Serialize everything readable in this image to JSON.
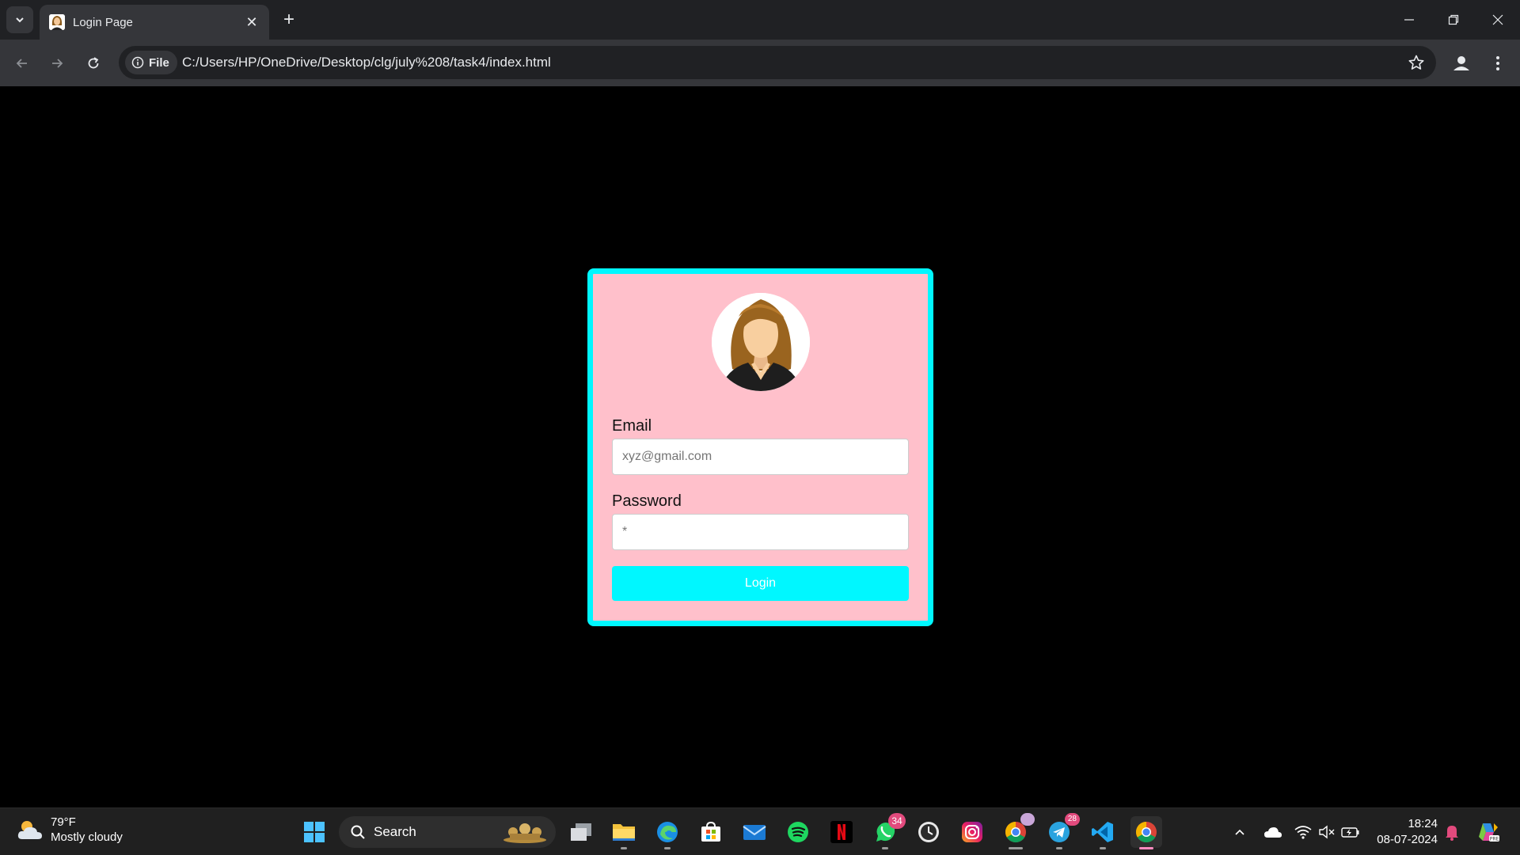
{
  "browser": {
    "tab_title": "Login Page",
    "tab_close": "✕",
    "new_tab": "+",
    "site_chip": "File",
    "url": "C:/Users/HP/OneDrive/Desktop/clg/july%208/task4/index.html"
  },
  "login": {
    "email_label": "Email",
    "email_placeholder": "xyz@gmail.com",
    "password_label": "Password",
    "password_placeholder": "*",
    "button_label": "Login"
  },
  "taskbar": {
    "weather_temp": "79°F",
    "weather_desc": "Mostly cloudy",
    "search_label": "Search",
    "whatsapp_badge": "34",
    "telegram_badge": "28",
    "time": "18:24",
    "date": "08-07-2024"
  },
  "colors": {
    "card_background": "#ffc0cb",
    "card_border": "#00f7ff",
    "button": "#00f7ff",
    "page_background": "#000000"
  }
}
